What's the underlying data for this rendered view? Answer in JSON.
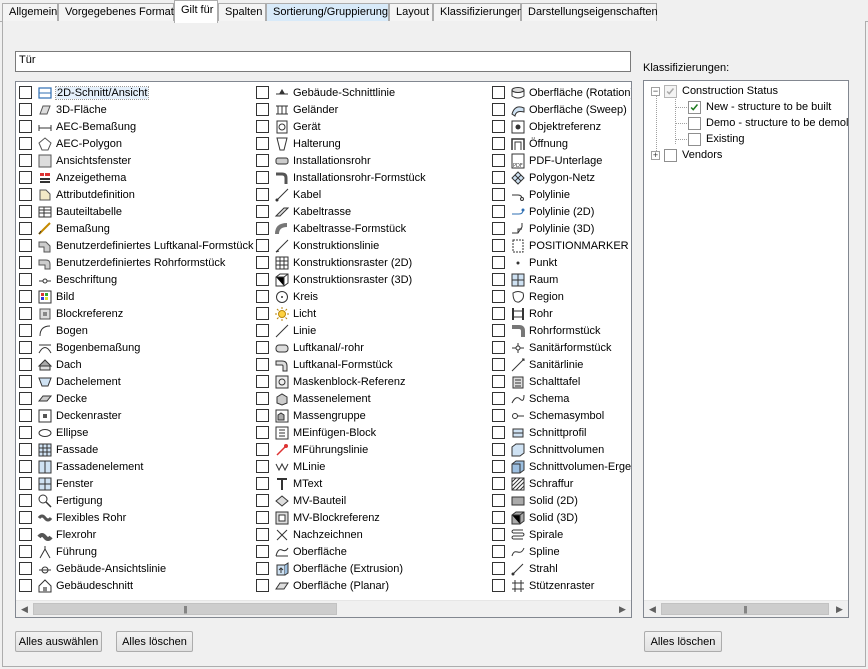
{
  "tabs": [
    {
      "label": "Allgemein",
      "state": "normal"
    },
    {
      "label": "Vorgegebenes Format",
      "state": "normal"
    },
    {
      "label": "Gilt für",
      "state": "active"
    },
    {
      "label": "Spalten",
      "state": "normal"
    },
    {
      "label": "Sortierung/Gruppierung",
      "state": "hot"
    },
    {
      "label": "Layout",
      "state": "normal"
    },
    {
      "label": "Klassifizierungen",
      "state": "normal"
    },
    {
      "label": "Darstellungseigenschaften",
      "state": "normal"
    }
  ],
  "filter": {
    "value": "Tür"
  },
  "object_columns": [
    [
      {
        "label": "2D-Schnitt/Ansicht",
        "icon": "2d-section-icon",
        "selected": true
      },
      {
        "label": "3D-Fläche",
        "icon": "3d-face-icon"
      },
      {
        "label": "AEC-Bemaßung",
        "icon": "aec-dimension-icon"
      },
      {
        "label": "AEC-Polygon",
        "icon": "aec-polygon-icon"
      },
      {
        "label": "Ansichtsfenster",
        "icon": "viewport-icon"
      },
      {
        "label": "Anzeigethema",
        "icon": "display-theme-icon"
      },
      {
        "label": "Attributdefinition",
        "icon": "attribute-definition-icon"
      },
      {
        "label": "Bauteiltabelle",
        "icon": "schedule-table-icon"
      },
      {
        "label": "Bemaßung",
        "icon": "dimension-icon"
      },
      {
        "label": "Benutzerdefiniertes Luftkanal-Formstück",
        "icon": "custom-duct-fitting-icon"
      },
      {
        "label": "Benutzerdefiniertes Rohrformstück",
        "icon": "custom-pipe-fitting-icon"
      },
      {
        "label": "Beschriftung",
        "icon": "label-icon"
      },
      {
        "label": "Bild",
        "icon": "image-icon"
      },
      {
        "label": "Blockreferenz",
        "icon": "block-reference-icon"
      },
      {
        "label": "Bogen",
        "icon": "arc-icon"
      },
      {
        "label": "Bogenbemaßung",
        "icon": "arc-dimension-icon"
      },
      {
        "label": "Dach",
        "icon": "roof-icon"
      },
      {
        "label": "Dachelement",
        "icon": "roof-slab-icon"
      },
      {
        "label": "Decke",
        "icon": "slab-icon"
      },
      {
        "label": "Deckenraster",
        "icon": "ceiling-grid-icon"
      },
      {
        "label": "Ellipse",
        "icon": "ellipse-icon"
      },
      {
        "label": "Fassade",
        "icon": "curtain-wall-icon"
      },
      {
        "label": "Fassadenelement",
        "icon": "curtain-wall-unit-icon"
      },
      {
        "label": "Fenster",
        "icon": "window-icon"
      },
      {
        "label": "Fertigung",
        "icon": "fabrication-icon"
      },
      {
        "label": "Flexibles Rohr",
        "icon": "flexible-pipe-icon"
      },
      {
        "label": "Flexrohr",
        "icon": "flex-duct-icon"
      },
      {
        "label": "Führung",
        "icon": "leader-icon"
      },
      {
        "label": "Gebäude-Ansichtslinie",
        "icon": "building-elevation-line-icon"
      },
      {
        "label": "Gebäudeschnitt",
        "icon": "building-section-icon"
      }
    ],
    [
      {
        "label": "Gebäude-Schnittlinie",
        "icon": "building-section-line-icon"
      },
      {
        "label": "Geländer",
        "icon": "railing-icon"
      },
      {
        "label": "Gerät",
        "icon": "device-icon"
      },
      {
        "label": "Halterung",
        "icon": "hanger-icon"
      },
      {
        "label": "Installationsrohr",
        "icon": "conduit-icon"
      },
      {
        "label": "Installationsrohr-Formstück",
        "icon": "conduit-fitting-icon"
      },
      {
        "label": "Kabel",
        "icon": "wire-icon"
      },
      {
        "label": "Kabeltrasse",
        "icon": "cable-tray-icon"
      },
      {
        "label": "Kabeltrasse-Formstück",
        "icon": "cable-tray-fitting-icon"
      },
      {
        "label": "Konstruktionslinie",
        "icon": "construction-line-icon"
      },
      {
        "label": "Konstruktionsraster (2D)",
        "icon": "layout-grid-2d-icon"
      },
      {
        "label": "Konstruktionsraster (3D)",
        "icon": "layout-grid-3d-icon"
      },
      {
        "label": "Kreis",
        "icon": "circle-icon"
      },
      {
        "label": "Licht",
        "icon": "light-icon"
      },
      {
        "label": "Linie",
        "icon": "line-icon"
      },
      {
        "label": "Luftkanal/-rohr",
        "icon": "duct-icon"
      },
      {
        "label": "Luftkanal-Formstück",
        "icon": "duct-fitting-icon"
      },
      {
        "label": "Maskenblock-Referenz",
        "icon": "mask-block-icon"
      },
      {
        "label": "Massenelement",
        "icon": "mass-element-icon"
      },
      {
        "label": "Massengruppe",
        "icon": "mass-group-icon"
      },
      {
        "label": "MEinfügen-Block",
        "icon": "minsert-block-icon"
      },
      {
        "label": "MFührungslinie",
        "icon": "mleader-icon"
      },
      {
        "label": "MLinie",
        "icon": "mline-icon"
      },
      {
        "label": "MText",
        "icon": "mtext-icon"
      },
      {
        "label": "MV-Bauteil",
        "icon": "mv-part-icon"
      },
      {
        "label": "MV-Blockreferenz",
        "icon": "mv-block-icon"
      },
      {
        "label": "Nachzeichnen",
        "icon": "trace-icon"
      },
      {
        "label": "Oberfläche",
        "icon": "surface-icon"
      },
      {
        "label": "Oberfläche (Extrusion)",
        "icon": "surface-extrusion-icon"
      },
      {
        "label": "Oberfläche (Planar)",
        "icon": "surface-planar-icon"
      }
    ],
    [
      {
        "label": "Oberfläche (Rotation)",
        "icon": "surface-revolve-icon"
      },
      {
        "label": "Oberfläche (Sweep)",
        "icon": "surface-sweep-icon"
      },
      {
        "label": "Objektreferenz",
        "icon": "object-reference-icon"
      },
      {
        "label": "Öffnung",
        "icon": "opening-icon"
      },
      {
        "label": "PDF-Unterlage",
        "icon": "pdf-underlay-icon"
      },
      {
        "label": "Polygon-Netz",
        "icon": "polygon-mesh-icon"
      },
      {
        "label": "Polylinie",
        "icon": "polyline-icon"
      },
      {
        "label": "Polylinie (2D)",
        "icon": "polyline-2d-icon"
      },
      {
        "label": "Polylinie (3D)",
        "icon": "polyline-3d-icon"
      },
      {
        "label": "POSITIONMARKER",
        "icon": "position-marker-icon"
      },
      {
        "label": "Punkt",
        "icon": "point-icon"
      },
      {
        "label": "Raum",
        "icon": "space-icon"
      },
      {
        "label": "Region",
        "icon": "region-icon"
      },
      {
        "label": "Rohr",
        "icon": "pipe-icon"
      },
      {
        "label": "Rohrformstück",
        "icon": "pipe-fitting-icon"
      },
      {
        "label": "Sanitärformstück",
        "icon": "plumbing-fitting-icon"
      },
      {
        "label": "Sanitärlinie",
        "icon": "plumbing-line-icon"
      },
      {
        "label": "Schalttafel",
        "icon": "panel-icon"
      },
      {
        "label": "Schema",
        "icon": "schematic-icon"
      },
      {
        "label": "Schemasymbol",
        "icon": "schematic-symbol-icon"
      },
      {
        "label": "Schnittprofil",
        "icon": "section-profile-icon"
      },
      {
        "label": "Schnittvolumen",
        "icon": "section-volume-icon"
      },
      {
        "label": "Schnittvolumen-Ergeb",
        "icon": "section-volume-result-icon"
      },
      {
        "label": "Schraffur",
        "icon": "hatch-icon"
      },
      {
        "label": "Solid (2D)",
        "icon": "solid-2d-icon"
      },
      {
        "label": "Solid (3D)",
        "icon": "solid-3d-icon"
      },
      {
        "label": "Spirale",
        "icon": "helix-icon"
      },
      {
        "label": "Spline",
        "icon": "spline-icon"
      },
      {
        "label": "Strahl",
        "icon": "ray-icon"
      },
      {
        "label": "Stützenraster",
        "icon": "column-grid-icon"
      }
    ]
  ],
  "buttons": {
    "select_all": "Alles auswählen",
    "clear_all": "Alles löschen",
    "clear_all_classifications": "Alles löschen"
  },
  "classifications": {
    "label": "Klassifizierungen:",
    "tree": [
      {
        "label": "Construction Status",
        "checked": true,
        "disabled": true,
        "expanded": true,
        "children": [
          {
            "label": "New - structure to be built",
            "checked": true
          },
          {
            "label": "Demo - structure to be demolis",
            "checked": false
          },
          {
            "label": "Existing",
            "checked": false
          }
        ]
      },
      {
        "label": "Vendors",
        "checked": false,
        "expanded": false
      }
    ]
  },
  "colors": {
    "accent": "#3c7fb1",
    "check_green": "#1e7a1e",
    "icon_blue": "#2f6fb3"
  }
}
